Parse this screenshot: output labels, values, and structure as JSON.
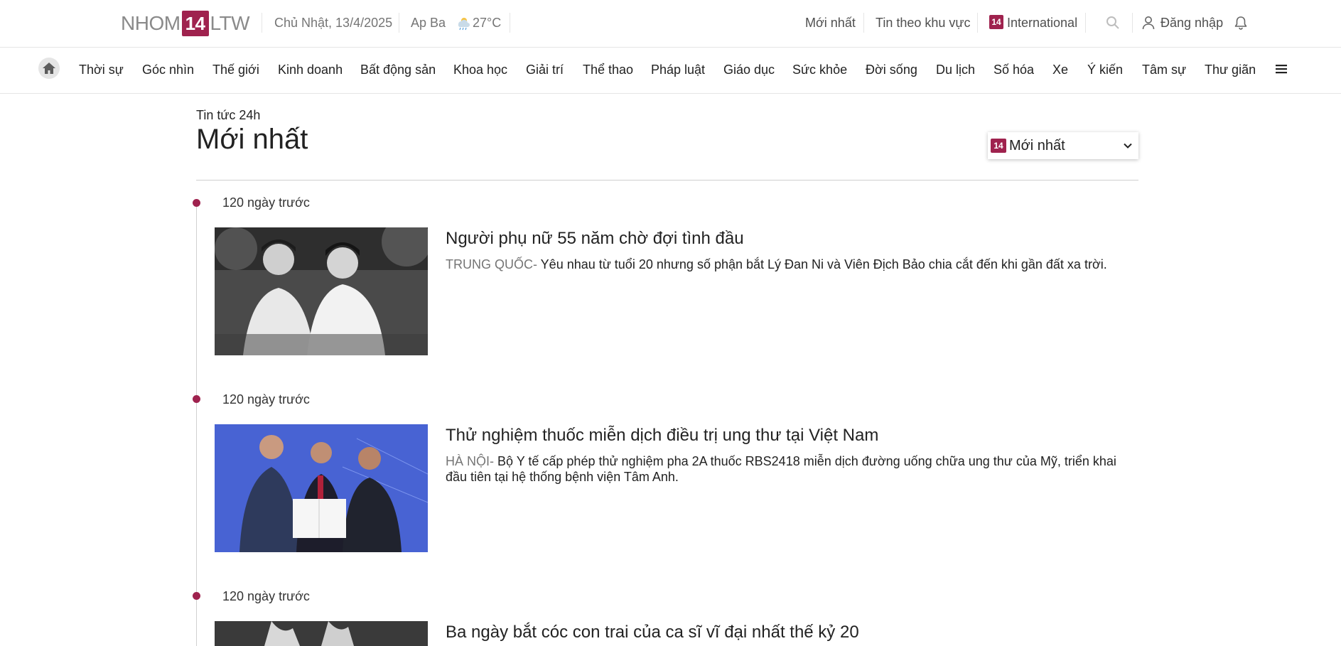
{
  "topbar": {
    "logo_left": "NHOM",
    "logo_mark": "14",
    "logo_right": "LTW",
    "date": "Chủ Nhật, 13/4/2025",
    "location": "Ap Ba",
    "temperature": "27°C",
    "links": {
      "latest": "Mới nhất",
      "regional": "Tin theo khu vực",
      "international": "International"
    },
    "international_mark": "14",
    "login": "Đăng nhập"
  },
  "nav": {
    "items": [
      "Thời sự",
      "Góc nhìn",
      "Thế giới",
      "Kinh doanh",
      "Bất động sản",
      "Khoa học",
      "Giải trí",
      "Thể thao",
      "Pháp luật",
      "Giáo dục",
      "Sức khỏe",
      "Đời sống",
      "Du lịch",
      "Số hóa",
      "Xe",
      "Ý kiến",
      "Tâm sự",
      "Thư giãn"
    ]
  },
  "page": {
    "kicker": "Tin tức 24h",
    "title": "Mới nhất",
    "sort": {
      "mark": "14",
      "selected": "Mới nhất"
    }
  },
  "articles": [
    {
      "time": "120 ngày trước",
      "title": "Người phụ nữ 55 năm chờ đợi tình đầu",
      "location": "TRUNG QUỐC-",
      "description": " Yêu nhau từ tuổi 20 nhưng số phận bắt Lý Đan Ni và Viên Địch Bảo chia cắt đến khi gần đất xa trời."
    },
    {
      "time": "120 ngày trước",
      "title": "Thử nghiệm thuốc miễn dịch điều trị ung thư tại Việt Nam",
      "location": "HÀ NỘI-",
      "description": " Bộ Y tế cấp phép thử nghiệm pha 2A thuốc RBS2418 miễn dịch đường uống chữa ung thư của Mỹ, triển khai đầu tiên tại hệ thống bệnh viện Tâm Anh."
    },
    {
      "time": "120 ngày trước",
      "title": "Ba ngày bắt cóc con trai của ca sĩ vĩ đại nhất thế kỷ 20",
      "location": "",
      "description": ""
    }
  ],
  "colors": {
    "brand": "#9f224e",
    "text": "#222222",
    "muted": "#757575"
  }
}
